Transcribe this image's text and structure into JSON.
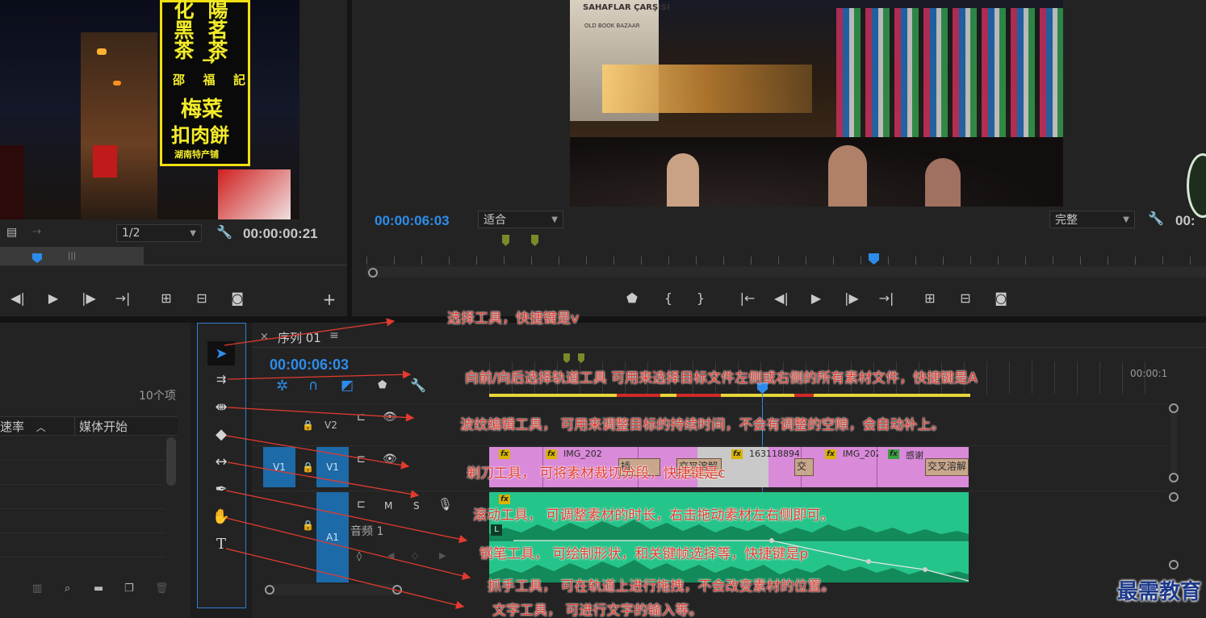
{
  "source_monitor": {
    "sign_lines": [
      "化",
      "陽",
      "黑",
      "茗",
      "茶",
      "茶",
      "→",
      "邵",
      "福",
      "記",
      "梅菜",
      "扣肉餅",
      "湖南特产铺"
    ],
    "resolution": "1/2",
    "timecode": "00:00:00:21"
  },
  "program_monitor": {
    "timecode": "00:00:06:03",
    "fit": "适合",
    "quality": "完整",
    "right_timecode": "00:",
    "sign_text": "SAHAFLAR ÇARŞISI",
    "sign_sub": "OLD BOOK BAZAAR"
  },
  "project": {
    "count": "10个项",
    "col_rate": "速率",
    "col_media_start": "媒体开始"
  },
  "timeline": {
    "tab_close": "×",
    "tab_title": "序列 01",
    "tab_menu": "≡",
    "timecode": "00:00:06:03",
    "ruler_end": "00:00:1",
    "tracks": {
      "v2_label": "V2",
      "v1_src": "V1",
      "v1_label": "V1",
      "a1_label": "A1",
      "a1_name": "音频 1",
      "m": "M",
      "s": "S"
    },
    "clips": {
      "c1": "IMG_202",
      "c2": "1631188942",
      "c3": "IMG_202",
      "c4": "感谢",
      "t1": "插",
      "t2": "交叉溶解",
      "t3": "交",
      "t4": "交叉溶解",
      "audio_l": "L"
    }
  },
  "annotations": [
    "选择工具，快捷键是v",
    "向前/向后选择轨道工具   可用来选择目标文件左侧或右侧的所有素材文件，快捷键是A",
    "波纹编辑工具，   可用来调整目标的持续时间，不会有调整的空隙，会自动补上。",
    "剃刀工具，   可将素材裁切分段，快捷键是c",
    "滚动工具，   可调整素材的时长，右击拖动素材左右侧即可。",
    "钢笔工具，   可绘制形状，和关键帧选择等，快捷键是p",
    "抓手工具，   可在轨道上进行拖拽，不会改变素材的位置。",
    "文字工具，   可进行文字的输入等。"
  ],
  "watermark": "最需教育",
  "colors": {
    "accent_blue": "#2d8ceb",
    "annotation_red": "#e23b2e",
    "clip_pink": "#d98ad9",
    "clip_green": "#25c48a",
    "track_blue": "#1d6aa8"
  }
}
